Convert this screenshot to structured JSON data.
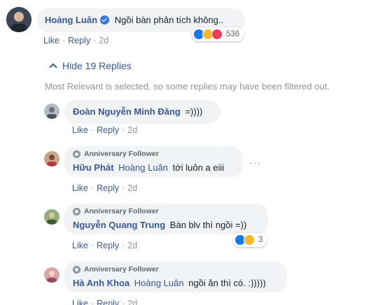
{
  "top_comment": {
    "author": "Hoàng Luân",
    "text": "Ngồi bàn phân tích không..",
    "reaction_count": "536",
    "reactions": [
      "like-icon",
      "haha-icon",
      "love-icon"
    ],
    "actions": {
      "like": "Like",
      "reply": "Reply",
      "time": "2d"
    }
  },
  "hide_replies": "Hide 19 Replies",
  "filter_notice": "Most Relevant is selected, so some replies may have been filtered out.",
  "replies": [
    {
      "author": "Đoàn Nguyễn Minh Đăng",
      "text": "=))))",
      "actions": {
        "like": "Like",
        "reply": "Reply",
        "time": "2d"
      }
    },
    {
      "badge": "Anniversary Follower",
      "author": "Hữu Phát",
      "mention": "Hoàng Luân",
      "text": "tới luôn a eiii",
      "actions": {
        "like": "Like",
        "reply": "Reply",
        "time": "2d"
      }
    },
    {
      "badge": "Anniversary Follower",
      "author": "Nguyễn Quang Trung",
      "text": "Bàn blv thì ngồi =))",
      "reaction_count": "3",
      "reactions": [
        "like-icon",
        "haha-icon"
      ],
      "actions": {
        "like": "Like",
        "reply": "Reply",
        "time": "2d"
      }
    },
    {
      "badge": "Anniversary Follower",
      "author": "Hà Anh Khoa",
      "mention": "Hoàng Luân",
      "text": "ngồi ăn thì có. :)))))",
      "actions": {
        "like": "Like",
        "reply": "Reply",
        "time": "2d"
      }
    }
  ],
  "colors": {
    "link": "#385898",
    "bubble": "#f2f3f5",
    "meta": "#90949c",
    "like": "#1877f2"
  }
}
